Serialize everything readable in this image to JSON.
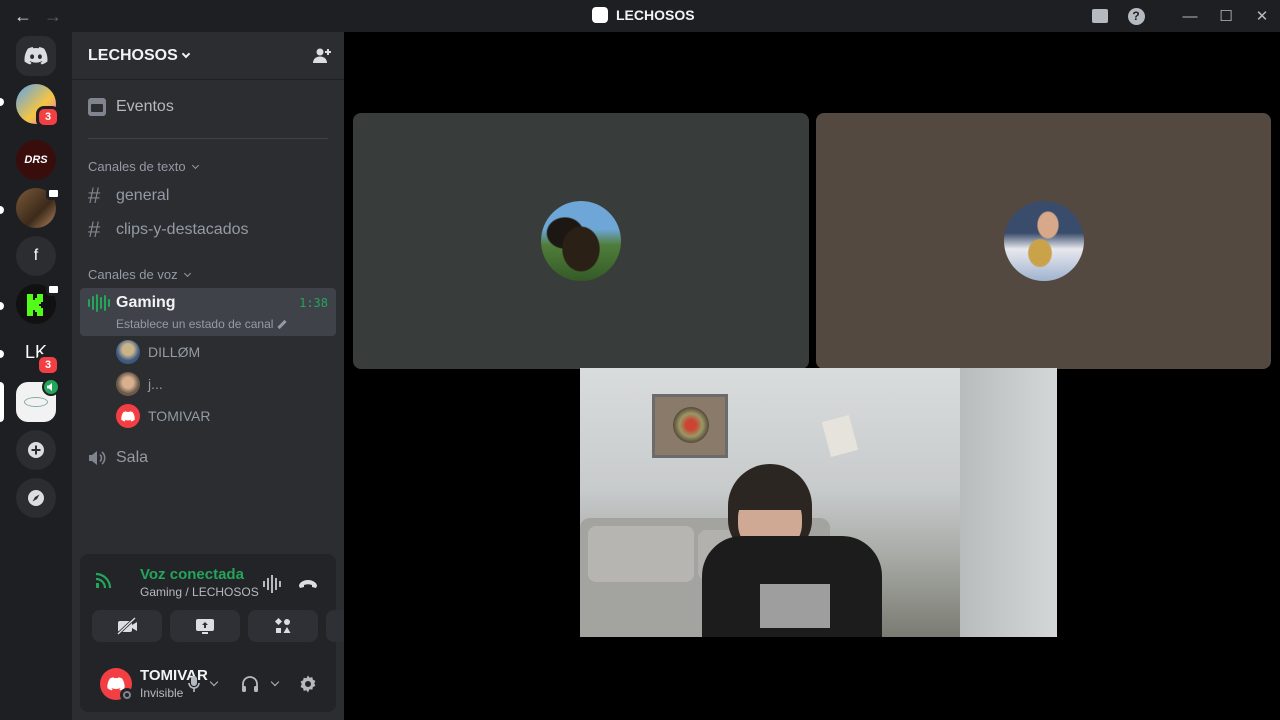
{
  "titlebar": {
    "title": "LECHOSOS",
    "back": "←",
    "forward": "→",
    "minimize": "—",
    "maximize": "☐",
    "close": "✕",
    "help": "?"
  },
  "servers": [
    {
      "name": "server-1",
      "badge": "3"
    },
    {
      "name": "drs-cup",
      "label": "DRS"
    },
    {
      "name": "server-3"
    },
    {
      "name": "f-server",
      "label": "f"
    },
    {
      "name": "kick-server"
    },
    {
      "name": "lk-server",
      "label": "LK",
      "badge": "3"
    },
    {
      "name": "active-voice-server"
    }
  ],
  "guild": {
    "name": "LECHOSOS"
  },
  "events_label": "Eventos",
  "categories": {
    "text": "Canales de texto",
    "voice": "Canales de voz"
  },
  "text_channels": [
    "general",
    "clips-y-destacados"
  ],
  "voice_channel": {
    "name": "Gaming",
    "timer": "1:38",
    "status": "Establece un estado de canal"
  },
  "voice_users": [
    "DILLØM",
    "j...",
    "TOMIVAR"
  ],
  "sala": "Sala",
  "voice_panel": {
    "title": "Voz conectada",
    "subtitle": "Gaming / LECHOSOS"
  },
  "user": {
    "name": "TOMIVAR",
    "status": "Invisible"
  },
  "colors": {
    "accent_green": "#23a55a",
    "danger": "#f23f43",
    "blurple": "#5865f2"
  }
}
